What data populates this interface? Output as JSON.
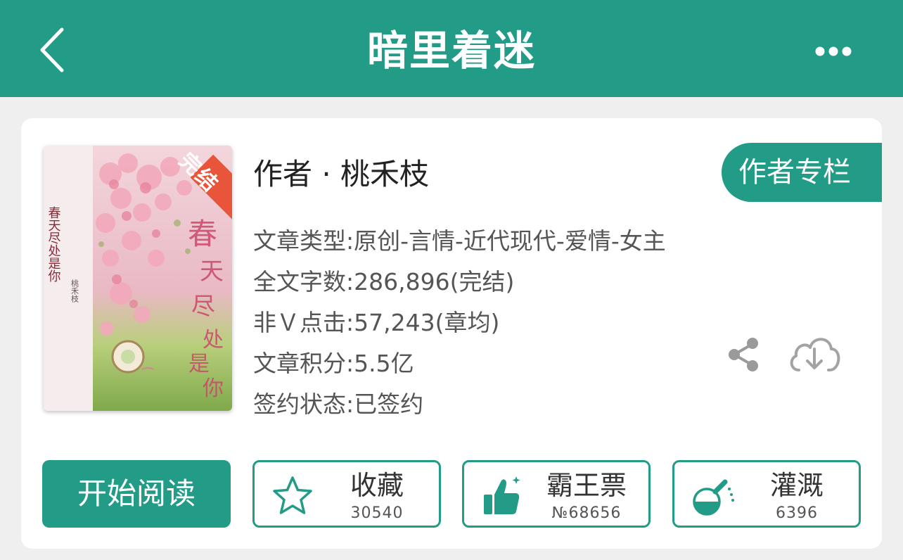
{
  "header": {
    "title": "暗里着迷"
  },
  "book": {
    "cover_badge": "完结",
    "cover_title": "春天尽处是你",
    "author_line": "作者 · 桃禾枝",
    "author_column_label": "作者专栏",
    "info": [
      "文章类型:原创-言情-近代现代-爱情-女主",
      "全文字数:286,896(完结)",
      "非Ｖ点击:57,243(章均)",
      "文章积分:5.5亿",
      "签约状态:已签约"
    ]
  },
  "actions": {
    "read_label": "开始阅读",
    "favorite": {
      "label": "收藏",
      "count": "30540"
    },
    "ticket": {
      "label": "霸王票",
      "count": "№68656"
    },
    "nutrient": {
      "label": "灌溉",
      "count": "6396"
    }
  },
  "icons": {
    "back": "chevron-left-icon",
    "more": "more-horizontal-icon",
    "share": "share-icon",
    "download": "cloud-download-icon",
    "favorite": "star-icon",
    "ticket": "thumbs-up-icon",
    "nutrient": "flask-icon"
  },
  "colors": {
    "accent": "#229c87",
    "background": "#efefef",
    "text": "#222222",
    "muted_text": "#555555"
  }
}
